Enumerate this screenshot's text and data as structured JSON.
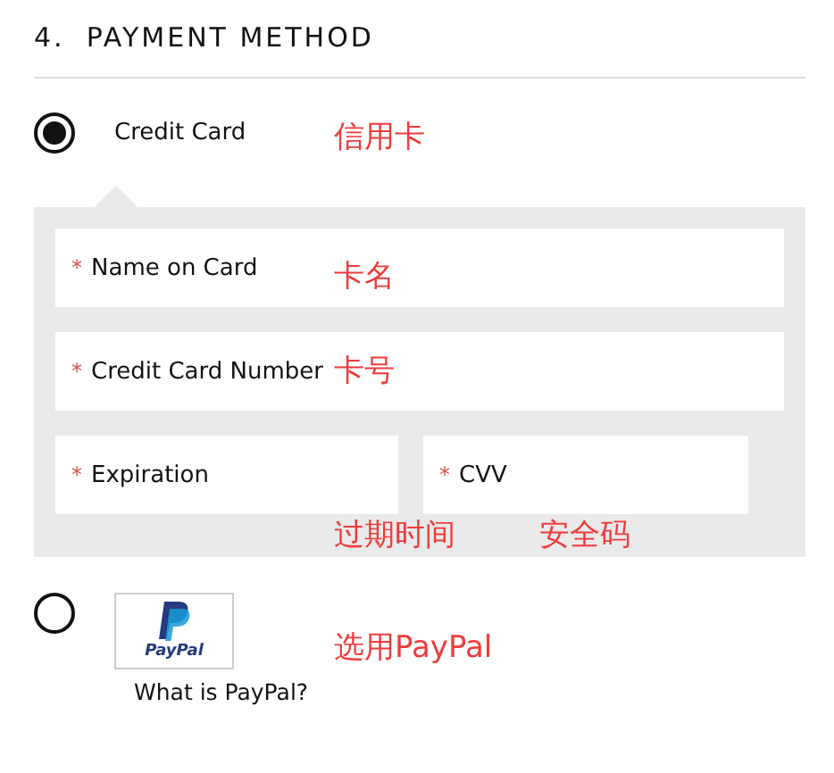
{
  "section": {
    "number": "4.",
    "title": "PAYMENT METHOD"
  },
  "options": [
    {
      "kind": "card",
      "label": "Credit Card",
      "selected": true
    },
    {
      "kind": "paypal",
      "logo_text": "PayPal",
      "link": "What is PayPal?",
      "selected": false
    }
  ],
  "card_fields": [
    {
      "marker": "*",
      "label": "Name on Card"
    },
    {
      "marker": "*",
      "label": "Credit Card Number"
    },
    {
      "marker": "*",
      "label": "Expiration"
    },
    {
      "marker": "*",
      "label": "CVV"
    }
  ],
  "annotations": [
    {
      "text": "信用卡"
    },
    {
      "text": "卡名"
    },
    {
      "text": "卡号"
    },
    {
      "text": "过期时间"
    },
    {
      "text": "安全码"
    },
    {
      "text": "选用PayPal"
    }
  ]
}
